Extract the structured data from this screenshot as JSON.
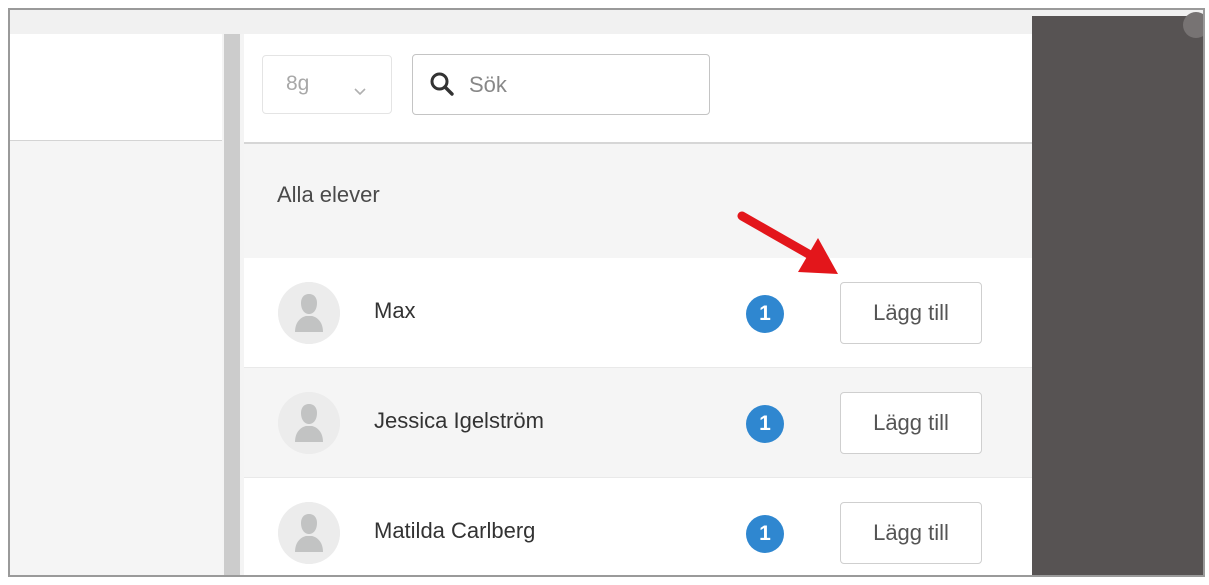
{
  "toolbar": {
    "class_select": {
      "value": "8g"
    },
    "search": {
      "placeholder": "Sök",
      "value": ""
    }
  },
  "section": {
    "title": "Alla elever"
  },
  "students": [
    {
      "name": "Max",
      "badge": "1",
      "action": "Lägg till"
    },
    {
      "name": "Jessica Igelström",
      "badge": "1",
      "action": "Lägg till"
    },
    {
      "name": "Matilda Carlberg",
      "badge": "1",
      "action": "Lägg till"
    }
  ],
  "colors": {
    "badge": "#2f87d0",
    "annotation_arrow": "#e3161b",
    "overlay": "#575353"
  },
  "icons": {
    "search": "search-icon",
    "dropdown": "chevron-down-icon",
    "avatar": "user-placeholder-icon",
    "annotation": "red-arrow-icon"
  }
}
